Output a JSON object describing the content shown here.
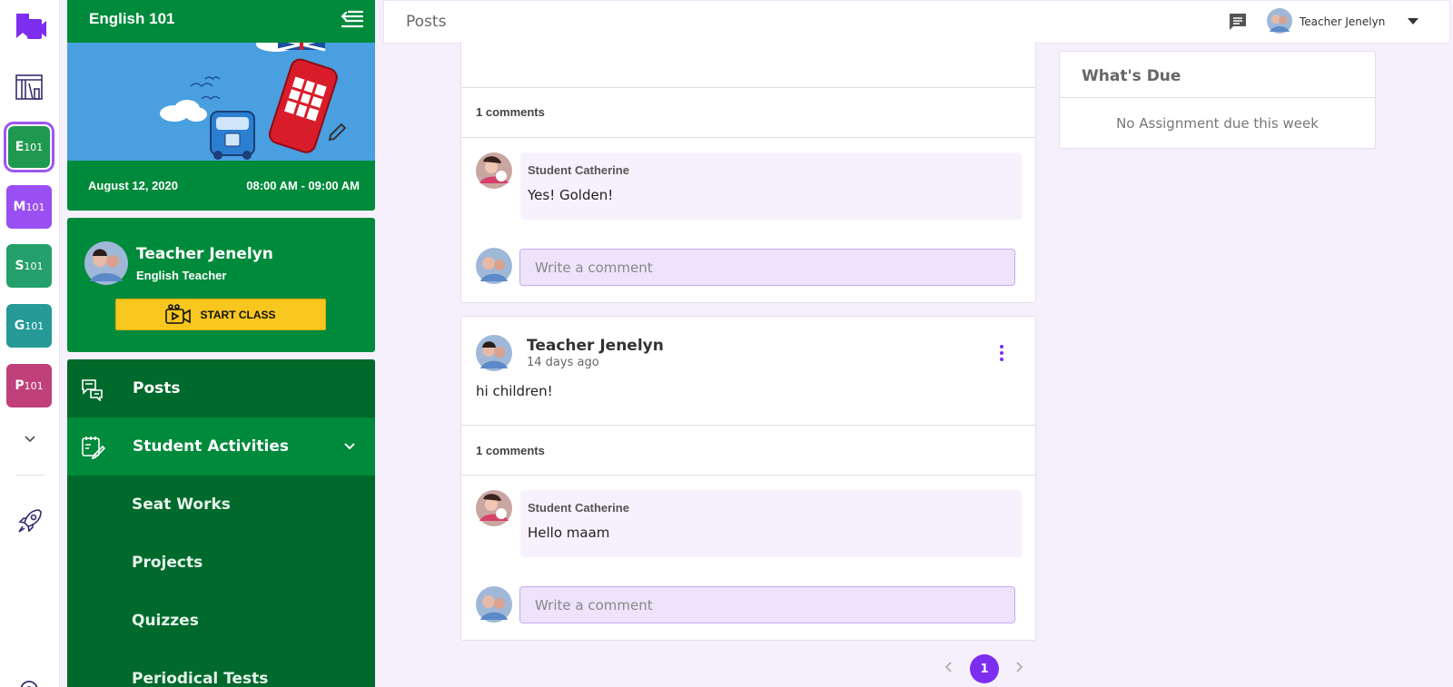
{
  "course_nav": {
    "courses": [
      {
        "code_letter": "E",
        "code_number": "101",
        "color": "#1f9950",
        "active": true
      },
      {
        "code_letter": "M",
        "code_number": "101",
        "color": "#9a4ff2"
      },
      {
        "code_letter": "S",
        "code_number": "101",
        "color": "#25a06a"
      },
      {
        "code_letter": "G",
        "code_number": "101",
        "color": "#259a97"
      },
      {
        "code_letter": "P",
        "code_number": "101",
        "color": "#c0407a"
      }
    ]
  },
  "course_panel": {
    "title": "English 101",
    "date": "August 12, 2020",
    "time": "08:00 AM - 09:00 AM",
    "teacher_name": "Teacher Jenelyn",
    "teacher_role": "English Teacher",
    "start_class_label": "START CLASS"
  },
  "menu": {
    "posts": "Posts",
    "student_activities": "Student Activities",
    "sub": [
      "Seat Works",
      "Projects",
      "Quizzes",
      "Periodical Tests"
    ]
  },
  "header": {
    "page_title": "Posts",
    "user_name": "Teacher Jenelyn"
  },
  "feed": {
    "post1": {
      "comments_count": "1 comments",
      "comment_author": "Student Catherine",
      "comment_text": "Yes! Golden!",
      "write_placeholder": "Write a comment"
    },
    "post2": {
      "author": "Teacher Jenelyn",
      "time": "14 days ago",
      "body": "hi children!",
      "comments_count": "1 comments",
      "comment_author": "Student Catherine",
      "comment_text": "Hello maam",
      "write_placeholder": "Write a comment"
    }
  },
  "pagination": {
    "current": "1"
  },
  "whats_due": {
    "title": "What's Due",
    "empty": "No Assignment due this week"
  },
  "colors": {
    "brand_purple": "#7c2df0",
    "green": "#008a3b",
    "dark_green": "#00692c",
    "yellow": "#f7c71f"
  }
}
